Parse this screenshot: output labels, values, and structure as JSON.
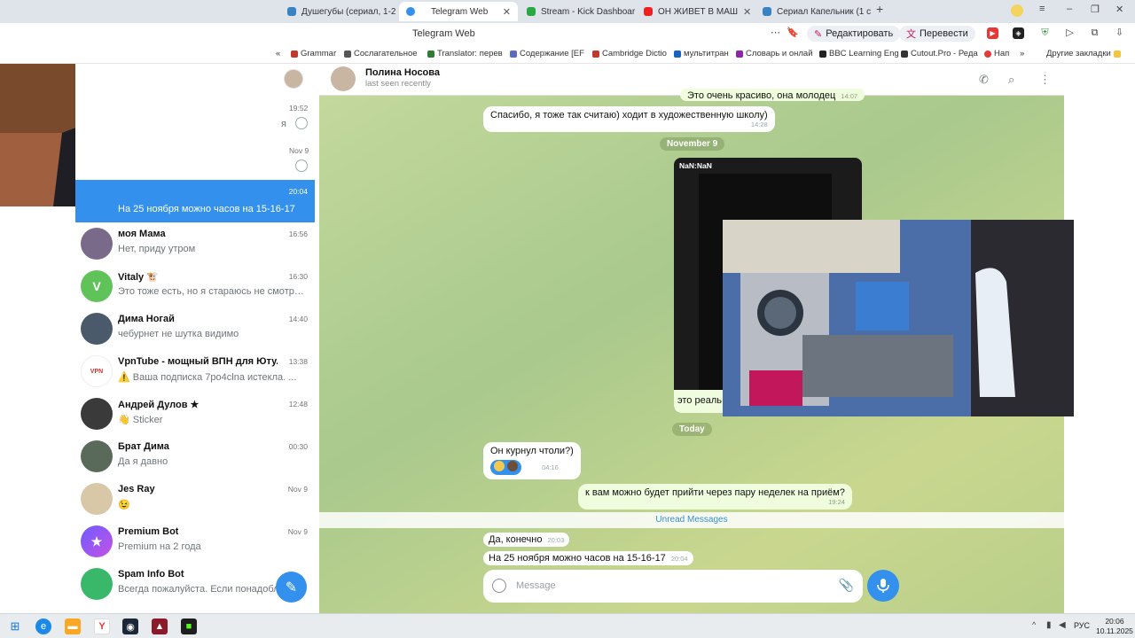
{
  "browser": {
    "tabs": [
      {
        "label": "Душегубы (сериал, 1-2 се",
        "color": "#3b82c4"
      },
      {
        "label": "Telegram Web",
        "color": "#3390ec",
        "active": true
      },
      {
        "label": "Stream - Kick Dashboard",
        "color": "#28a745"
      },
      {
        "label": "ОН ЖИВЕТ В МАШ",
        "color": "#e22"
      },
      {
        "label": "Сериал Капельник (1 се",
        "color": "#3b82c4"
      }
    ],
    "page_title": "Telegram Web",
    "edit_label": "Редактировать",
    "translate_label": "Перевести",
    "bookmarks": [
      "Grammar",
      "Сослагательное",
      "Translator: перев",
      "Содержание [EF",
      "Cambridge Dictio",
      "мультитран",
      "Словарь и онлай",
      "BBC Learning Eng",
      "Cutout.Pro - Реда",
      "Нап"
    ],
    "other_bookmarks": "Другие закладки"
  },
  "sidebar": {
    "partial_times": [
      "19:52",
      "Nov 9"
    ],
    "partial_char": "я",
    "chats": [
      {
        "name": "",
        "preview": "На 25 ноября можно часов на 15-16-17",
        "time": "20:04",
        "selected": true,
        "avatar_color": "#3390ec",
        "avatar_letter": ""
      },
      {
        "name": "моя Мама",
        "preview": "Нет, приду утром",
        "time": "16:56",
        "avatar_color": "#7a6a8a",
        "avatar_letter": ""
      },
      {
        "name": "Vitaly 🐮",
        "preview": "Это тоже есть, но я стараюсь не смотрет...",
        "time": "16:30",
        "avatar_color": "#5fc35a",
        "avatar_letter": "V"
      },
      {
        "name": "Дима Ногай",
        "preview": "чебурнет не шутка видимо",
        "time": "14:40",
        "avatar_color": "#4a5a6a",
        "avatar_letter": ""
      },
      {
        "name": "VpnTube - мощный ВПН для Юту...",
        "preview": "⚠️ Ваша подписка 7po4clna истекла. ...",
        "time": "13:38",
        "avatar_color": "#ffffff",
        "avatar_letter": "VPN"
      },
      {
        "name": "Андрей Дулов ★",
        "preview": "👋 Sticker",
        "time": "12:48",
        "avatar_color": "#3a3a3a",
        "avatar_letter": ""
      },
      {
        "name": "Брат Дима",
        "preview": "Да я давно",
        "time": "00:30",
        "avatar_color": "#5a6a5a",
        "avatar_letter": ""
      },
      {
        "name": "Jes Ray",
        "preview": "😉",
        "time": "Nov 9",
        "avatar_color": "#d8c8a8",
        "avatar_letter": ""
      },
      {
        "name": "Premium Bot",
        "preview": "Premium на 2 года",
        "time": "Nov 9",
        "avatar_color": "#8b5cf6",
        "avatar_letter": "★"
      },
      {
        "name": "Spam Info Bot",
        "preview": "Всегда пожалуйста. Если понадобл...",
        "time": "",
        "avatar_color": "#3ab86a",
        "avatar_letter": ""
      }
    ]
  },
  "chat": {
    "contact_name": "Полина Носова",
    "status": "last seen recently",
    "messages": [
      {
        "text": "Это очень красиво, она молодец",
        "time": "14:07",
        "dir": "out"
      },
      {
        "text": "Спасибо, я тоже так считаю) ходит в художественную школу)",
        "time": "14:28",
        "dir": "in"
      },
      {
        "text": "Он курнул чтоли?)",
        "time": "04:16",
        "dir": "in"
      },
      {
        "text": "к вам можно будет прийти через пару неделек на приём?",
        "time": "19:24",
        "dir": "out"
      },
      {
        "text": "Да, конечно",
        "time": "20:03",
        "dir": "in"
      },
      {
        "text": "На 25 ноября можно часов на 15-16-17",
        "time": "20:04",
        "dir": "in"
      }
    ],
    "date_nov9": "November 9",
    "date_today": "Today",
    "video_label": "NaN:NaN",
    "video_caption": "это реаль",
    "unread_label": "Unread Messages",
    "composer_placeholder": "Message"
  },
  "taskbar": {
    "lang": "РУС",
    "time": "20:06",
    "date": "10.11.2025"
  }
}
